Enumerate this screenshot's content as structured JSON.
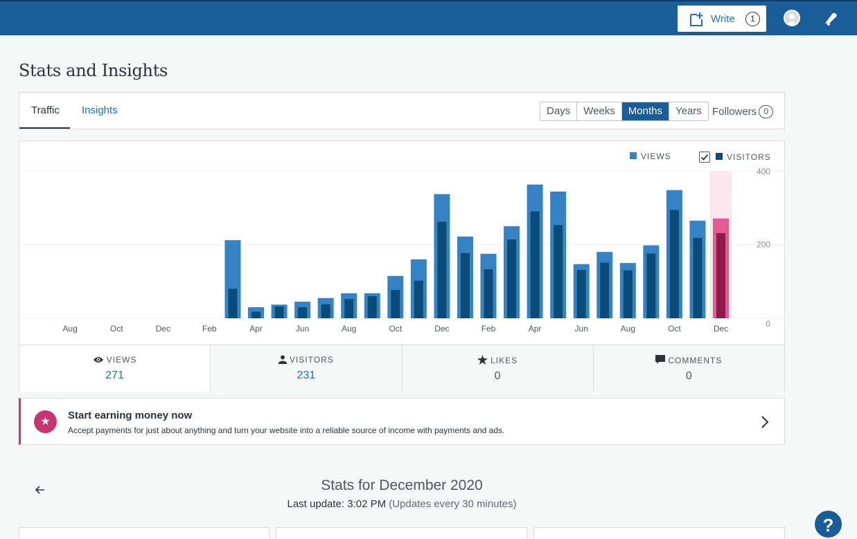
{
  "masterbar": {
    "write_label": "Write",
    "write_count": "1"
  },
  "page_title": "Stats and Insights",
  "tabs": {
    "traffic": "Traffic",
    "insights": "Insights"
  },
  "periods": [
    "Days",
    "Weeks",
    "Months",
    "Years"
  ],
  "active_period": "Months",
  "followers": {
    "label": "Followers",
    "count": "0"
  },
  "legend": {
    "views": "VIEWS",
    "visitors": "VISITORS"
  },
  "colors": {
    "views": "#3582c4",
    "visitors": "#0a4b78",
    "selected_views": "#e65a93",
    "selected_visitors": "#8c1a4b",
    "selected_band": "#fbe7ee",
    "brand": "#1a5e99"
  },
  "chart_data": {
    "type": "bar",
    "x_tick_labels": [
      "Aug",
      "Oct",
      "Dec",
      "Feb",
      "Apr",
      "Jun",
      "Aug",
      "Oct",
      "Dec",
      "Feb",
      "Apr",
      "Jun",
      "Aug",
      "Oct",
      "Dec"
    ],
    "y_tick_labels": [
      "0",
      "200",
      "400"
    ],
    "ylim": [
      0,
      400
    ],
    "series": [
      {
        "name": "VIEWS",
        "values": [
          0,
          0,
          0,
          0,
          0,
          0,
          0,
          0,
          0,
          0,
          0,
          0,
          0,
          0,
          0,
          0,
          0,
          0,
          0,
          0,
          0,
          0,
          0,
          0,
          0,
          0,
          0,
          0,
          0,
          0,
          0,
          0,
          0,
          0,
          0,
          0,
          0,
          0,
          0,
          0,
          0,
          212,
          30,
          37,
          45,
          55,
          68,
          68,
          115,
          160,
          337,
          222,
          175,
          250,
          363,
          344,
          147,
          180,
          150,
          198,
          348,
          265,
          271
        ]
      },
      {
        "name": "VISITORS",
        "values": [
          0,
          0,
          0,
          0,
          0,
          0,
          0,
          0,
          0,
          0,
          0,
          0,
          0,
          0,
          0,
          0,
          0,
          0,
          0,
          0,
          0,
          0,
          0,
          0,
          0,
          0,
          0,
          0,
          0,
          0,
          0,
          0,
          0,
          0,
          0,
          0,
          0,
          0,
          0,
          0,
          0,
          80,
          18,
          32,
          30,
          38,
          52,
          60,
          77,
          102,
          262,
          177,
          133,
          214,
          290,
          253,
          131,
          151,
          130,
          176,
          294,
          218,
          231
        ]
      }
    ],
    "grid": true,
    "legend_position": "top-right"
  },
  "tiles": [
    {
      "label": "VIEWS",
      "value": "271"
    },
    {
      "label": "VISITORS",
      "value": "231"
    },
    {
      "label": "LIKES",
      "value": "0"
    },
    {
      "label": "COMMENTS",
      "value": "0"
    }
  ],
  "earn": {
    "title": "Start earning money now",
    "description": "Accept payments for just about anything and turn your website into a reliable source of income with payments and ads."
  },
  "stats_for": "Stats for December 2020",
  "last_update": {
    "label": "Last update: 3:02 PM",
    "note": "(Updates every 30 minutes)"
  },
  "help_label": "?"
}
